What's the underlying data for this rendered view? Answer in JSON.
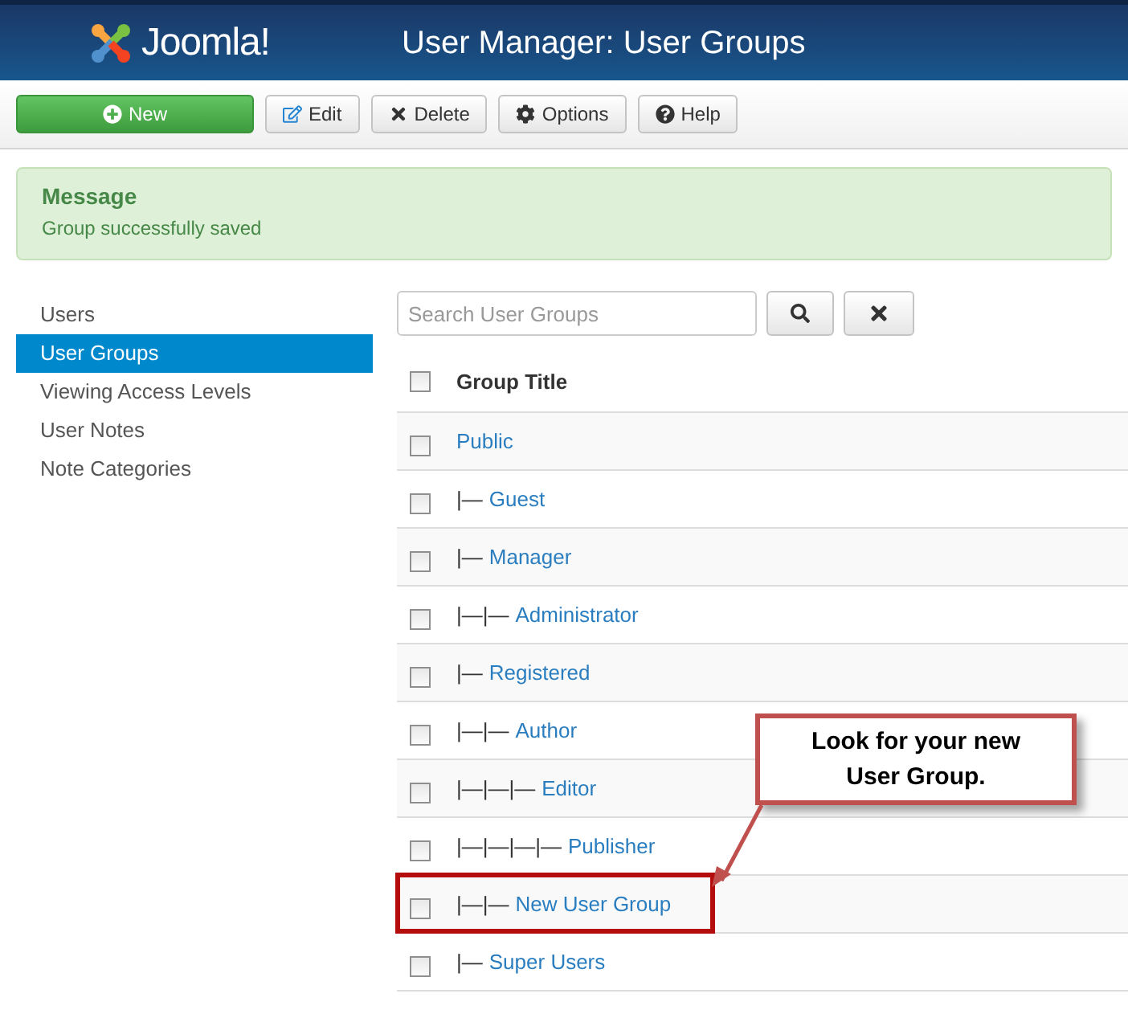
{
  "header": {
    "logo_text": "Joomla!",
    "title": "User Manager: User Groups"
  },
  "toolbar": [
    {
      "kind": "primary",
      "label": "New"
    },
    {
      "kind": "default",
      "label": "Edit"
    },
    {
      "kind": "default",
      "label": "Delete"
    },
    {
      "kind": "default",
      "label": "Options"
    },
    {
      "kind": "default",
      "label": "Help"
    }
  ],
  "message": {
    "heading": "Message",
    "text": "Group successfully saved"
  },
  "sidebar": {
    "items": [
      {
        "label": "Users",
        "selected": false
      },
      {
        "label": "User Groups",
        "selected": true
      },
      {
        "label": "Viewing Access Levels",
        "selected": false
      },
      {
        "label": "User Notes",
        "selected": false
      },
      {
        "label": "Note Categories",
        "selected": false
      }
    ]
  },
  "search": {
    "placeholder": "Search User Groups"
  },
  "table": {
    "select_all_checked": false,
    "columns": [
      "Group Title"
    ],
    "rows": [
      {
        "prefix": "",
        "title": "Public",
        "checked": false,
        "highlighted": false,
        "children": [
          {
            "prefix": "|—",
            "title": "Guest",
            "checked": false,
            "highlighted": false
          },
          {
            "prefix": "|—",
            "title": "Manager",
            "checked": false,
            "highlighted": false,
            "children": [
              {
                "prefix": "|—|—",
                "title": "Administrator",
                "checked": false,
                "highlighted": false
              }
            ]
          },
          {
            "prefix": "|—",
            "title": "Registered",
            "checked": false,
            "highlighted": false,
            "children": [
              {
                "prefix": "|—|—",
                "title": "Author",
                "checked": false,
                "highlighted": false,
                "children": [
                  {
                    "prefix": "|—|—|—",
                    "title": "Editor",
                    "checked": false,
                    "highlighted": false,
                    "children": [
                      {
                        "prefix": "|—|—|—|—",
                        "title": "Publisher",
                        "checked": false,
                        "highlighted": false
                      }
                    ]
                  }
                ]
              },
              {
                "prefix": "|—|—",
                "title": "New User Group",
                "checked": false,
                "highlighted": true
              }
            ]
          },
          {
            "prefix": "|—",
            "title": "Super Users",
            "checked": false,
            "highlighted": false
          }
        ]
      }
    ]
  },
  "callout": {
    "text": "Look for your new User Group."
  }
}
